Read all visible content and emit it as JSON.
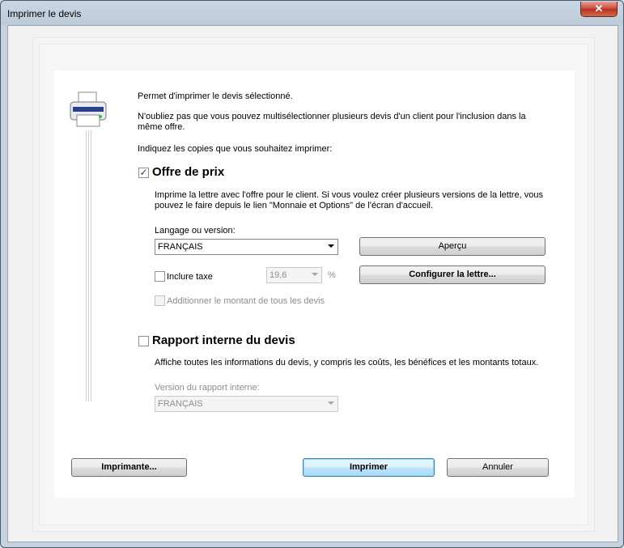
{
  "window": {
    "title": "Imprimer le devis",
    "close_glyph": "✕"
  },
  "intro": {
    "line1": "Permet d'imprimer le devis sélectionné.",
    "line2a": "N'oubliez pas que vous pouvez multisélectionner plusieurs devis d'un client pour l'inclusion dans la",
    "line2b": "même offre.",
    "line3": "Indiquez les copies que vous souhaitez imprimer:"
  },
  "offre": {
    "checked": true,
    "title": "Offre de prix",
    "desc1": "Imprime la lettre avec l'offre pour le client. Si vous voulez créer plusieurs versions de la lettre, vous",
    "desc2": "pouvez le faire depuis le lien \"Monnaie et Options\" de l'écran d'accueil.",
    "language_label": "Langage ou version:",
    "language_value": "FRANÇAIS",
    "apercu_label": "Aperçu",
    "inclure_taxe_label": "Inclure taxe",
    "tax_value": "19,6",
    "percent": "%",
    "configurer_label": "Configurer la lettre...",
    "additionner_label": "Additionner le montant de tous les devis"
  },
  "rapport": {
    "checked": false,
    "title": "Rapport interne du devis",
    "desc": "Affiche toutes les informations du devis, y compris les coûts, les bénéfices et les montants totaux.",
    "version_label": "Version du rapport interne:",
    "version_value": "FRANÇAIS"
  },
  "footer": {
    "imprimante_label": "Imprimante...",
    "imprimer_label": "Imprimer",
    "annuler_label": "Annuler"
  },
  "colors": {
    "close_button": "#c8473a",
    "default_button_border": "#3c7fb1"
  }
}
